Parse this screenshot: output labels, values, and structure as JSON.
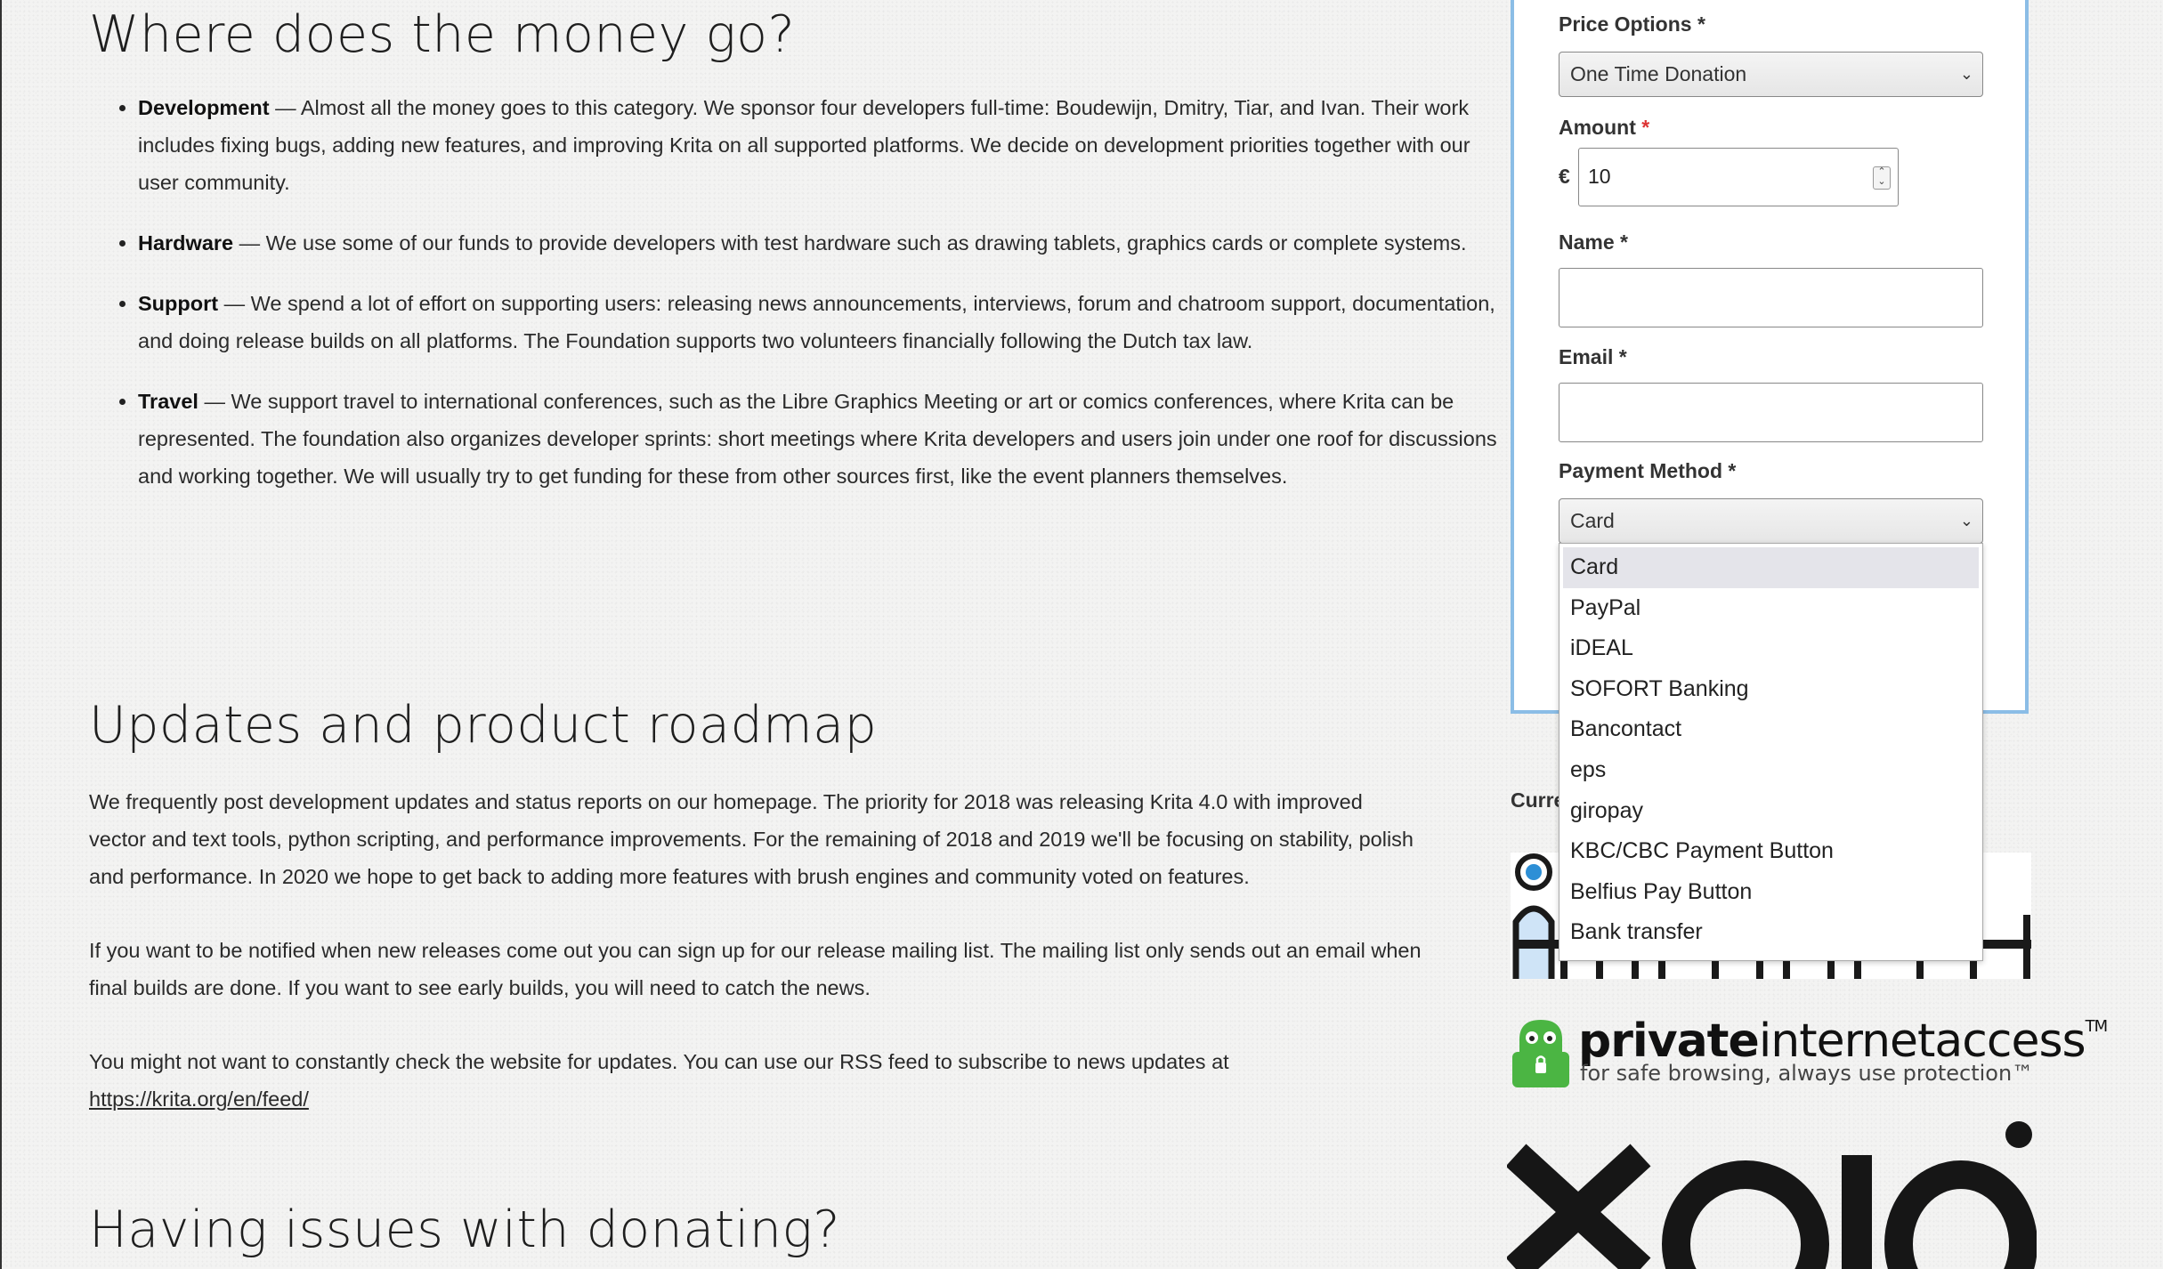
{
  "sections": {
    "money_title": "Where does the money go?",
    "updates_title": "Updates and product roadmap",
    "issues_title": "Having issues with donating?"
  },
  "money_items": [
    {
      "term": "Development",
      "text": " — Almost all the money goes to this category. We sponsor four developers full-time: Boudewijn, Dmitry, Tiar, and Ivan. Their work includes fixing bugs, adding new features, and improving Krita on all supported platforms. We decide on development priorities together with our user community."
    },
    {
      "term": "Hardware",
      "text": " — We use some of our funds to provide developers with test hardware such as drawing tablets, graphics cards or complete systems."
    },
    {
      "term": "Support",
      "text": " — We spend a lot of effort on supporting users: releasing news announcements, interviews, forum and chatroom support, documentation, and doing release builds on all platforms. The Foundation supports two volunteers financially following the Dutch tax law."
    },
    {
      "term": "Travel",
      "text": " — We support travel to international conferences, such as the Libre Graphics Meeting or art or comics conferences, where Krita can be represented. The foundation also organizes developer sprints: short meetings where Krita developers and users join under one roof for discussions and working together. We will usually try to get funding for these from other sources first, like the event planners themselves."
    }
  ],
  "updates": {
    "p1": "We frequently post development updates and status reports on our homepage. The priority for 2018 was releasing Krita 4.0 with improved vector and text tools, python scripting, and performance improvements. For the remaining of 2018 and 2019 we'll be focusing on stability, polish and performance. In 2020 we hope to get back to adding more features with brush engines and community voted on features.",
    "p2": "If you want to be notified when new releases come out you can sign up for our release mailing list. The mailing list only sends out an email when final builds are done. If you want to see early builds, you will need to catch the news.",
    "p3": "You might not want to constantly check the website for updates. You can use our RSS feed to subscribe to news updates at ",
    "feed_link": "https://krita.org/en/feed/"
  },
  "form": {
    "price_label": "Price Options",
    "price_value": "One Time Donation",
    "amount_label": "Amount",
    "currency": "€",
    "amount_value": "10",
    "name_label": "Name",
    "email_label": "Email",
    "payment_label": "Payment Method",
    "payment_value": "Card",
    "required_mark": "*",
    "payment_options": [
      "Card",
      "PayPal",
      "iDEAL",
      "SOFORT Banking",
      "Bancontact",
      "eps",
      "giropay",
      "KBC/CBC Payment Button",
      "Belfius Pay Button",
      "Bank transfer"
    ]
  },
  "sponsors": {
    "heading": "Curre",
    "pia_name_bold": "private",
    "pia_name_rest": "internetaccess",
    "pia_tm": "TM",
    "pia_tagline": "for safe browsing, always use protection™"
  }
}
